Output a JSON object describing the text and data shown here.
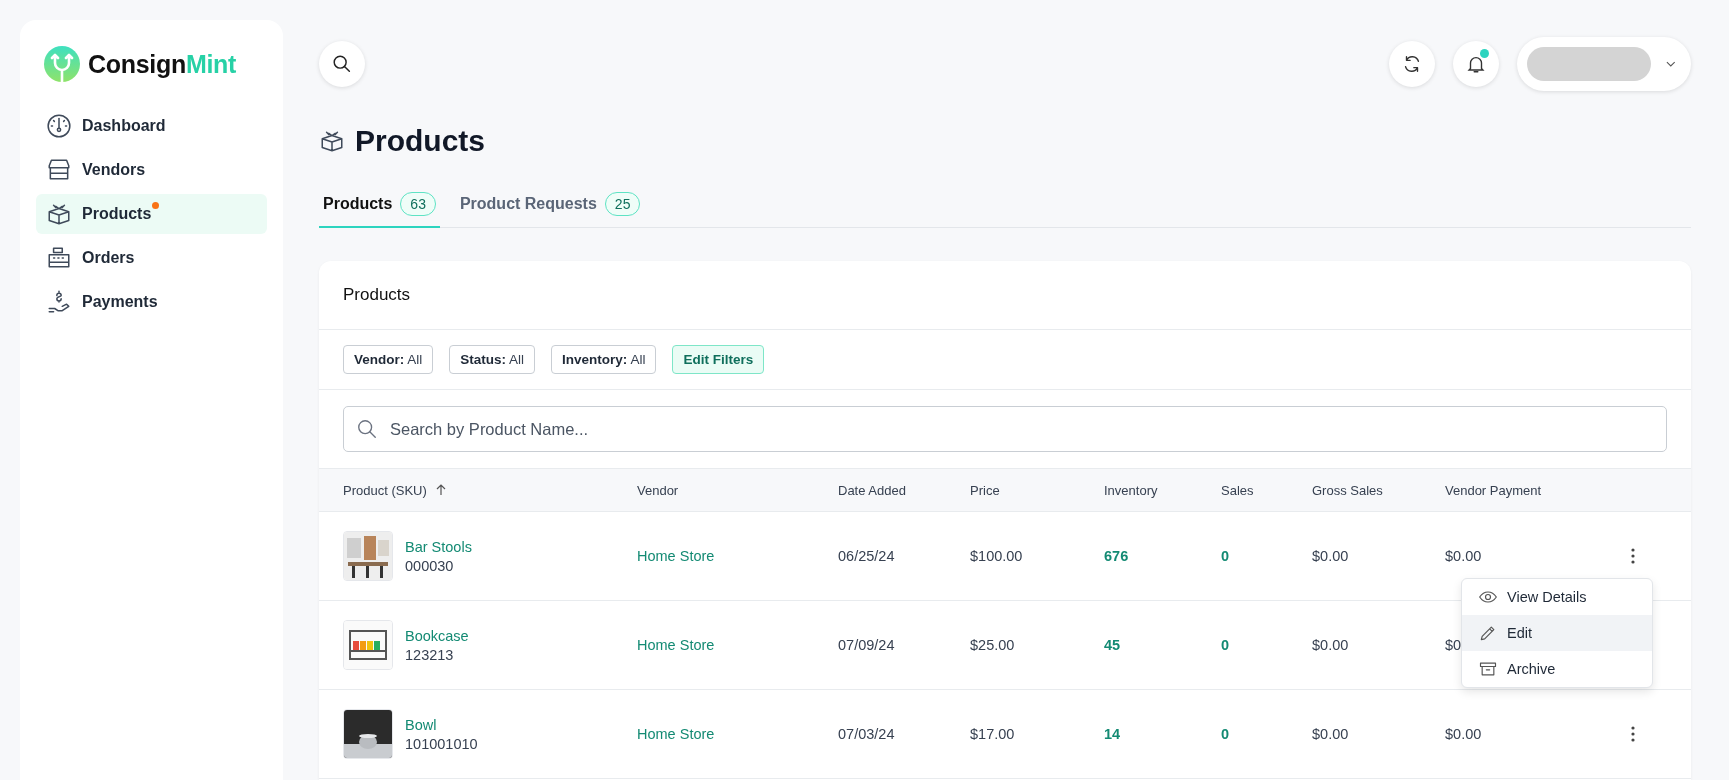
{
  "brand": {
    "first": "Consign",
    "second": "Mint"
  },
  "sidebar": {
    "items": [
      {
        "label": "Dashboard",
        "selected": false,
        "dot": false
      },
      {
        "label": "Vendors",
        "selected": false,
        "dot": false
      },
      {
        "label": "Products",
        "selected": true,
        "dot": true
      },
      {
        "label": "Orders",
        "selected": false,
        "dot": false
      },
      {
        "label": "Payments",
        "selected": false,
        "dot": false
      }
    ]
  },
  "topbar": {
    "notification_dot": true
  },
  "page_title": "Products",
  "tabs": [
    {
      "label": "Products",
      "count": "63",
      "selected": true
    },
    {
      "label": "Product Requests",
      "count": "25",
      "selected": false
    }
  ],
  "card": {
    "title": "Products",
    "filters": [
      {
        "label": "Vendor:",
        "value": "All"
      },
      {
        "label": "Status:",
        "value": "All"
      },
      {
        "label": "Inventory:",
        "value": "All"
      }
    ],
    "edit_filters": "Edit Filters",
    "search": {
      "placeholder": "Search by Product Name..."
    }
  },
  "table": {
    "columns": [
      {
        "label": "Product (SKU)",
        "sorted": true
      },
      {
        "label": "Vendor",
        "sorted": false
      },
      {
        "label": "Date Added",
        "sorted": false
      },
      {
        "label": "Price",
        "sorted": false
      },
      {
        "label": "Inventory",
        "sorted": false
      },
      {
        "label": "Sales",
        "sorted": false
      },
      {
        "label": "Gross Sales",
        "sorted": false
      },
      {
        "label": "Vendor Payment",
        "sorted": false
      }
    ],
    "rows": [
      {
        "name": "Bar Stools",
        "sku": "000030",
        "vendor": "Home Store",
        "date_added": "06/25/24",
        "price": "$100.00",
        "inventory": "676",
        "sales": "0",
        "gross_sales": "$0.00",
        "vendor_payment": "$0.00",
        "menu_open": true
      },
      {
        "name": "Bookcase",
        "sku": "123213",
        "vendor": "Home Store",
        "date_added": "07/09/24",
        "price": "$25.00",
        "inventory": "45",
        "sales": "0",
        "gross_sales": "$0.00",
        "vendor_payment": "$0",
        "menu_open": false
      },
      {
        "name": "Bowl",
        "sku": "101001010",
        "vendor": "Home Store",
        "date_added": "07/03/24",
        "price": "$17.00",
        "inventory": "14",
        "sales": "0",
        "gross_sales": "$0.00",
        "vendor_payment": "$0.00",
        "menu_open": false
      }
    ]
  },
  "row_menu": {
    "items": [
      {
        "label": "View Details",
        "selected": false
      },
      {
        "label": "Edit",
        "selected": true
      },
      {
        "label": "Archive",
        "selected": false
      }
    ]
  }
}
